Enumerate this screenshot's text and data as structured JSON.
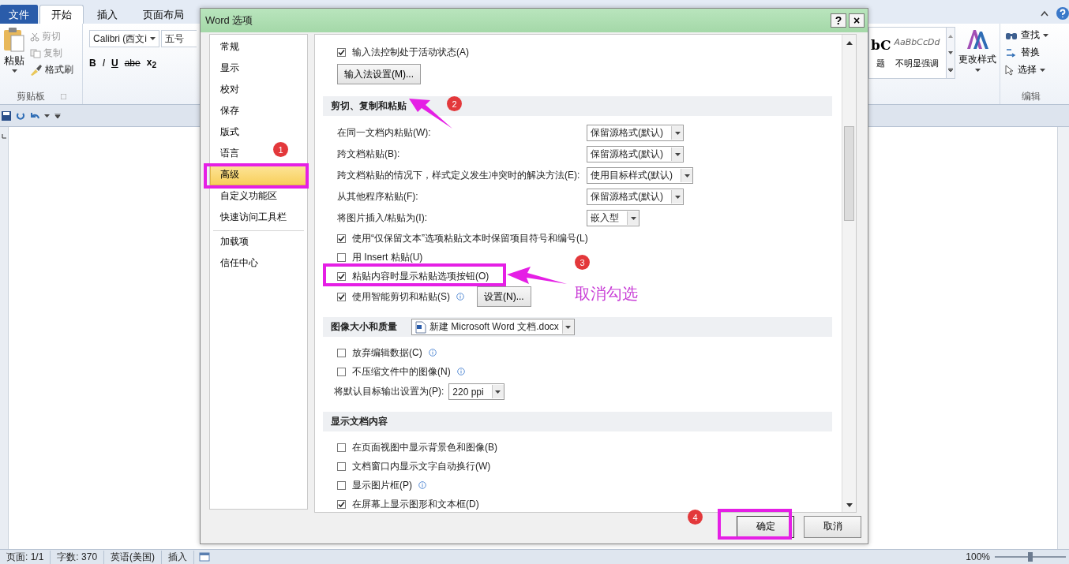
{
  "word": {
    "tabs": [
      {
        "label": "文件",
        "kind": "file",
        "selected": false
      },
      {
        "label": "开始",
        "kind": "tab",
        "selected": true
      },
      {
        "label": "插入",
        "kind": "tab",
        "selected": false
      },
      {
        "label": "页面布局",
        "kind": "tab",
        "selected": false
      }
    ],
    "clipboard": {
      "paste": "粘贴",
      "actions": [
        {
          "label": "剪切",
          "kind": "cut",
          "disabled": true
        },
        {
          "label": "复制",
          "kind": "copy",
          "disabled": true
        },
        {
          "label": "格式刷",
          "kind": "painter",
          "disabled": false
        }
      ],
      "group_label": "剪贴板"
    },
    "font": {
      "name": "Calibri (西文i",
      "size": "五号",
      "buttons": [
        {
          "label": "B",
          "kind": "bold"
        },
        {
          "label": "I",
          "kind": "italic"
        },
        {
          "label": "U",
          "kind": "underline"
        },
        {
          "label": "abe",
          "kind": "strike"
        },
        {
          "label": "x$_{2}$",
          "kind": "subscript"
        }
      ]
    },
    "styles": [
      {
        "preview": "bC",
        "name": "题",
        "kind": "heading"
      },
      {
        "preview": "AaBbCcDd",
        "name": "不明显强调",
        "kind": "subtle"
      }
    ],
    "change_styles": "更改样式",
    "editing": {
      "items": [
        {
          "label": "查找",
          "kind": "find",
          "dropdown": true
        },
        {
          "label": "替换",
          "kind": "replace",
          "dropdown": false
        },
        {
          "label": "选择",
          "kind": "select",
          "dropdown": true
        }
      ],
      "group_label": "编辑"
    },
    "status_bar": {
      "items": [
        "页面: 1/1",
        "字数: 370",
        "英语(美国)",
        "插入"
      ],
      "zoom": "100%",
      "zoom_slider": {
        "level": 0.5
      }
    }
  },
  "dialog": {
    "title": "Word 选项",
    "help": "?",
    "close": "×",
    "sidebar": {
      "groups": [
        {
          "items": [
            {
              "label": "常规",
              "selected": false
            },
            {
              "label": "显示",
              "selected": false
            },
            {
              "label": "校对",
              "selected": false
            },
            {
              "label": "保存",
              "selected": false
            },
            {
              "label": "版式",
              "selected": false
            },
            {
              "label": "语言",
              "selected": false
            },
            {
              "label": "高级",
              "selected": true
            },
            {
              "label": "自定义功能区",
              "selected": false
            },
            {
              "label": "快速访问工具栏",
              "selected": false
            }
          ]
        },
        {
          "items": [
            {
              "label": "加载项",
              "selected": false
            },
            {
              "label": "信任中心",
              "selected": false
            }
          ]
        }
      ]
    },
    "options": [
      {
        "kind": "checkbox",
        "label": "输入法控制处于活动状态(A)",
        "checked": true,
        "info": false
      },
      {
        "kind": "button",
        "label": "输入法设置(M)..."
      },
      {
        "kind": "section",
        "label": "剪切、复制和粘贴"
      },
      {
        "kind": "select",
        "label": "在同一文档内粘贴(W):",
        "value": "保留源格式(默认)"
      },
      {
        "kind": "select",
        "label": "跨文档粘贴(B):",
        "value": "保留源格式(默认)"
      },
      {
        "kind": "select",
        "label": "跨文档粘贴的情况下，样式定义发生冲突时的解决方法(E):",
        "value": "使用目标样式(默认)"
      },
      {
        "kind": "select",
        "label": "从其他程序粘贴(F):",
        "value": "保留源格式(默认)"
      },
      {
        "kind": "select",
        "label": "将图片插入/粘贴为(I):",
        "value": "嵌入型"
      },
      {
        "kind": "checkbox",
        "label": "使用“仅保留文本”选项粘贴文本时保留项目符号和编号(L)",
        "checked": true,
        "info": false
      },
      {
        "kind": "checkbox",
        "label": "用 Insert 粘贴(U)",
        "checked": false,
        "info": false
      },
      {
        "kind": "checkbox",
        "label": "粘贴内容时显示粘贴选项按钮(O)",
        "checked": true,
        "info": false
      },
      {
        "kind": "checkbox",
        "label": "使用智能剪切和粘贴(S)",
        "checked": true,
        "info": true,
        "button": "设置(N)..."
      },
      {
        "kind": "section",
        "label": "图像大小和质量",
        "value": "新建 Microsoft Word 文档.docx"
      },
      {
        "kind": "checkbox",
        "label": "放弃编辑数据(C)",
        "checked": false,
        "info": true
      },
      {
        "kind": "checkbox",
        "label": "不压缩文件中的图像(N)",
        "checked": false,
        "info": true
      },
      {
        "kind": "select_inline",
        "label": "将默认目标输出设置为(P):",
        "value": "220 ppi"
      },
      {
        "kind": "section",
        "label": "显示文档内容"
      },
      {
        "kind": "checkbox",
        "label": "在页面视图中显示背景色和图像(B)",
        "checked": false,
        "info": false
      },
      {
        "kind": "checkbox",
        "label": "文档窗口内显示文字自动换行(W)",
        "checked": false,
        "info": false
      },
      {
        "kind": "checkbox",
        "label": "显示图片框(P)",
        "checked": false,
        "info": true
      },
      {
        "kind": "checkbox",
        "label": "在屏幕上显示图形和文本框(D)",
        "checked": true,
        "info": false
      }
    ],
    "buttons": [
      {
        "label": "确定",
        "kind": "default"
      },
      {
        "label": "取消",
        "kind": "normal"
      }
    ]
  },
  "annotations": {
    "steps": [
      "1",
      "2",
      "3",
      "4"
    ],
    "note": "取消勾选"
  }
}
